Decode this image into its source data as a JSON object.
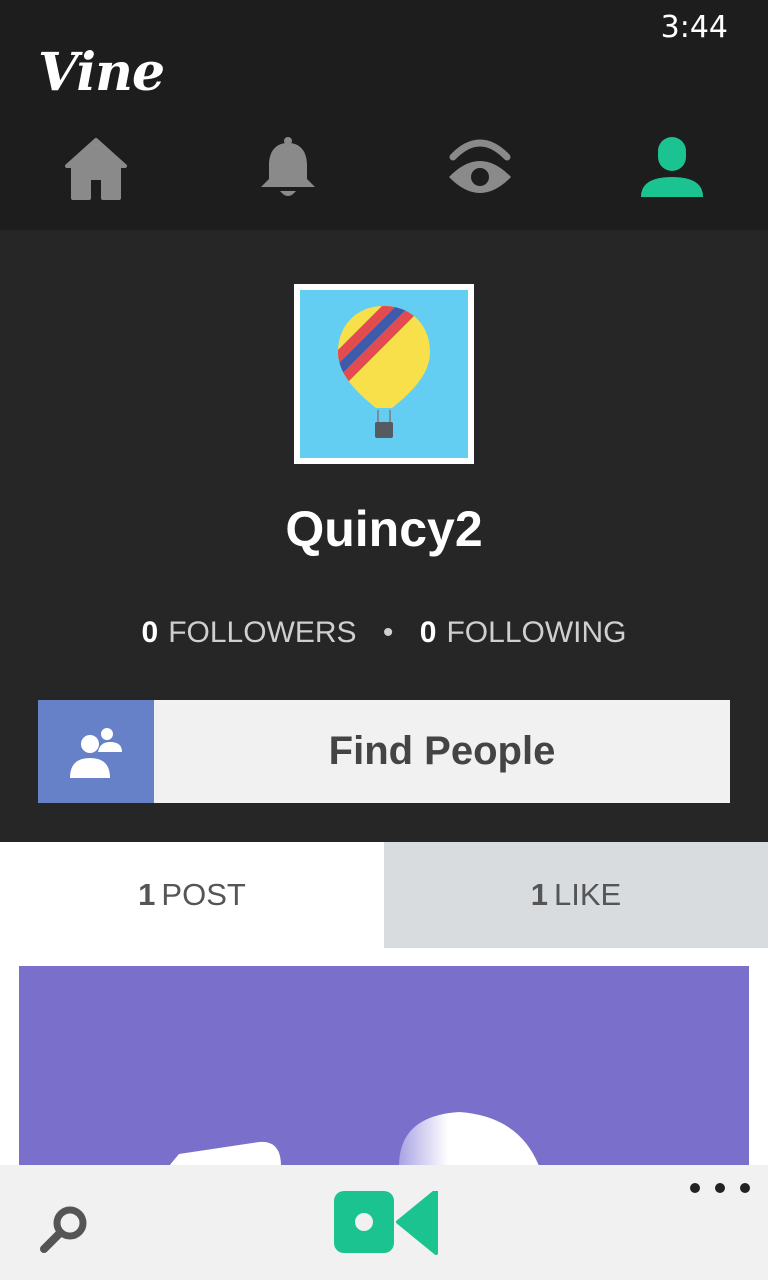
{
  "status_bar": {
    "time": "3:44"
  },
  "app": {
    "logo": "Vine"
  },
  "nav": {
    "items": [
      {
        "name": "home",
        "icon": "home-icon",
        "active": false
      },
      {
        "name": "notifications",
        "icon": "bell-icon",
        "active": false
      },
      {
        "name": "explore",
        "icon": "eye-icon",
        "active": false
      },
      {
        "name": "profile",
        "icon": "person-icon",
        "active": true
      }
    ],
    "active_color": "#1bc391",
    "inactive_color": "#8a8a8a"
  },
  "profile": {
    "avatar": "hot-air-balloon",
    "username": "Quincy2",
    "followers_count": "0",
    "followers_label": "FOLLOWERS",
    "separator": "•",
    "following_count": "0",
    "following_label": "FOLLOWING"
  },
  "find_people": {
    "label": "Find People",
    "icon": "add-people-icon",
    "accent": "#6681c8"
  },
  "tabs": [
    {
      "count": "1",
      "label": "POST",
      "selected": true
    },
    {
      "count": "1",
      "label": "LIKE",
      "selected": false
    }
  ],
  "post": {
    "background": "#7a70cb"
  },
  "bottom_bar": {
    "search_icon": "search-icon",
    "record_icon": "video-camera-icon",
    "record_color": "#1bc391",
    "more_icon": "more-dots-icon"
  }
}
